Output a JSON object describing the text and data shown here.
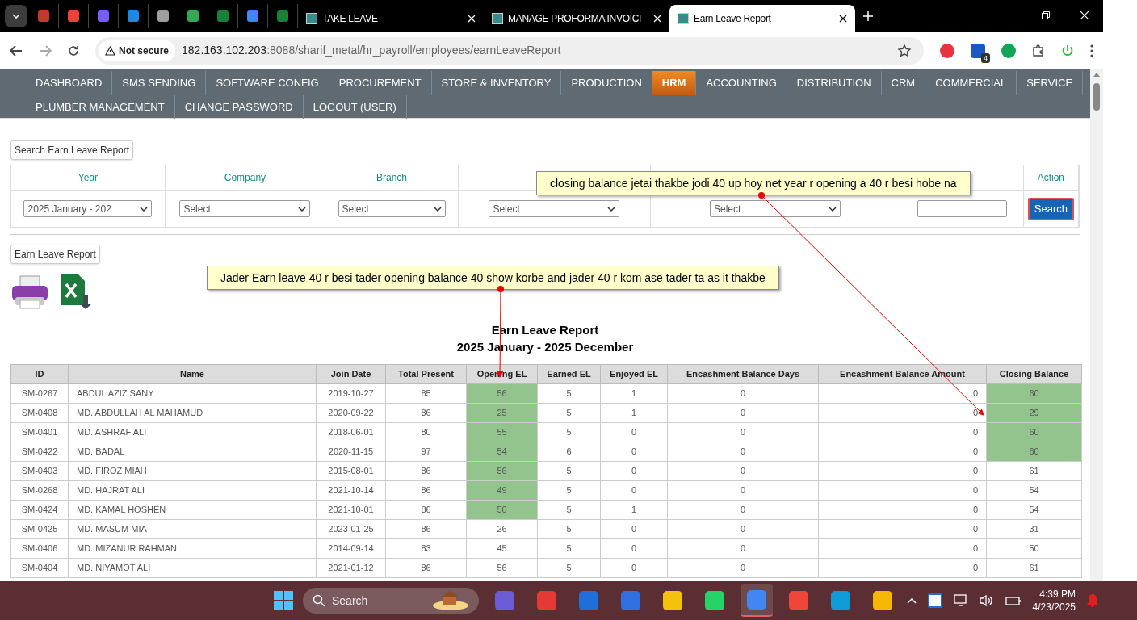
{
  "browser": {
    "tabs": [
      {
        "kind": "icon",
        "color": "#c0392b"
      },
      {
        "kind": "icon",
        "color": "#ea4335"
      },
      {
        "kind": "icon",
        "color": "#7b5cff"
      },
      {
        "kind": "icon",
        "color": "#1e88e5"
      },
      {
        "kind": "icon",
        "color": "#9e9e9e"
      },
      {
        "kind": "icon",
        "color": "#34a853"
      },
      {
        "kind": "icon",
        "color": "#188038"
      },
      {
        "kind": "icon",
        "color": "#4285f4"
      },
      {
        "kind": "icon",
        "color": "#188038"
      },
      {
        "kind": "titled",
        "title": "TAKE LEAVE",
        "selected": false
      },
      {
        "kind": "titled",
        "title": "MANAGE PROFORMA INVOICI",
        "selected": false
      },
      {
        "kind": "titled",
        "title": "Earn Leave Report",
        "selected": true
      }
    ],
    "security": "Not secure",
    "url_host": "182.163.102.203",
    "url_rest": ":8088/sharif_metal/hr_payroll/employees/earnLeaveReport",
    "extension_badge": "4"
  },
  "menu": [
    [
      {
        "label": "DASHBOARD",
        "selected": false
      },
      {
        "label": "SMS SENDING",
        "selected": false
      },
      {
        "label": "SOFTWARE CONFIG",
        "selected": false
      },
      {
        "label": "PROCUREMENT",
        "selected": false
      },
      {
        "label": "STORE & INVENTORY",
        "selected": false
      },
      {
        "label": "PRODUCTION",
        "selected": false
      },
      {
        "label": "HRM",
        "selected": true
      },
      {
        "label": "ACCOUNTING",
        "selected": false
      },
      {
        "label": "DISTRIBUTION",
        "selected": false
      },
      {
        "label": "CRM",
        "selected": false
      },
      {
        "label": "COMMERCIAL",
        "selected": false
      },
      {
        "label": "SERVICE",
        "selected": false
      }
    ],
    [
      {
        "label": "PLUMBER MANAGEMENT",
        "selected": false
      },
      {
        "label": "CHANGE PASSWORD",
        "selected": false
      },
      {
        "label": "LOGOUT (USER)",
        "selected": false
      }
    ]
  ],
  "search": {
    "legend": "Search Earn Leave Report",
    "columns": [
      {
        "label": "Year",
        "kind": "select",
        "value": "2025 January - 202"
      },
      {
        "label": "Company",
        "kind": "select",
        "value": "Select"
      },
      {
        "label": "Branch",
        "kind": "select",
        "value": "Select"
      },
      {
        "kind": "select",
        "value": "Select"
      },
      {
        "kind": "select",
        "value": "Select"
      },
      {
        "kind": "input"
      },
      {
        "label": "Action",
        "kind": "button",
        "value": "Search"
      }
    ]
  },
  "report": {
    "legend": "Earn Leave Report",
    "title": "Earn Leave Report",
    "period": "2025 January - 2025 December",
    "columns": [
      "ID",
      "Name",
      "Join Date",
      "Total Present",
      "Opening EL",
      "Earned EL",
      "Enjoyed EL",
      "Encashment Balance Days",
      "Encashment Balance Amount",
      "Closing Balance"
    ],
    "rows": [
      {
        "cells": [
          "SM-0267",
          "ABDUL AZIZ SANY",
          "2019-10-27",
          "85",
          "56",
          "5",
          "1",
          "0",
          "0",
          "60"
        ],
        "opening_highlighted": true,
        "closing_highlighted": true
      },
      {
        "cells": [
          "SM-0408",
          "MD. ABDULLAH AL MAHAMUD",
          "2020-09-22",
          "86",
          "25",
          "5",
          "1",
          "0",
          "0",
          "29"
        ],
        "opening_highlighted": true,
        "closing_highlighted": true
      },
      {
        "cells": [
          "SM-0401",
          "MD. ASHRAF ALI",
          "2018-06-01",
          "80",
          "55",
          "5",
          "0",
          "0",
          "0",
          "60"
        ],
        "opening_highlighted": true,
        "closing_highlighted": true
      },
      {
        "cells": [
          "SM-0422",
          "MD. BADAL",
          "2020-11-15",
          "97",
          "54",
          "6",
          "0",
          "0",
          "0",
          "60"
        ],
        "opening_highlighted": true,
        "closing_highlighted": true
      },
      {
        "cells": [
          "SM-0403",
          "MD. FIROZ MIAH",
          "2015-08-01",
          "86",
          "56",
          "5",
          "0",
          "0",
          "0",
          "61"
        ],
        "opening_highlighted": true,
        "closing_highlighted": false
      },
      {
        "cells": [
          "SM-0268",
          "MD. HAJRAT ALI",
          "2021-10-14",
          "86",
          "49",
          "5",
          "0",
          "0",
          "0",
          "54"
        ],
        "opening_highlighted": true,
        "closing_highlighted": false
      },
      {
        "cells": [
          "SM-0424",
          "MD. KAMAL HOSHEN",
          "2021-10-01",
          "86",
          "50",
          "5",
          "1",
          "0",
          "0",
          "54"
        ],
        "opening_highlighted": true,
        "closing_highlighted": false
      },
      {
        "cells": [
          "SM-0425",
          "MD. MASUM MIA",
          "2023-01-25",
          "86",
          "26",
          "5",
          "0",
          "0",
          "0",
          "31"
        ],
        "opening_highlighted": false,
        "closing_highlighted": false
      },
      {
        "cells": [
          "SM-0406",
          "MD. MIZANUR RAHMAN",
          "2014-09-14",
          "83",
          "45",
          "5",
          "0",
          "0",
          "0",
          "50"
        ],
        "opening_highlighted": false,
        "closing_highlighted": false
      },
      {
        "cells": [
          "SM-0404",
          "MD. NIYAMOT ALI",
          "2021-01-12",
          "86",
          "56",
          "5",
          "0",
          "0",
          "0",
          "61"
        ],
        "opening_highlighted": false,
        "closing_highlighted": false
      }
    ]
  },
  "annotations": [
    "closing balance jetai thakbe jodi 40 up hoy net year r opening a 40 r besi hobe na",
    "Jader Earn leave 40 r besi tader opening balance 40 show korbe and jader 40 r kom ase tader ta as it thakbe"
  ],
  "taskbar": {
    "search_placeholder": "Search",
    "time": "4:39 PM",
    "date": "4/23/2025",
    "apps": [
      {
        "color": "#6b5bd6"
      },
      {
        "color": "#e53935"
      },
      {
        "color": "#1e6fd9"
      },
      {
        "color": "#2f6fe0"
      },
      {
        "color": "#f4c20d"
      },
      {
        "color": "#25d366"
      },
      {
        "color": "#4285f4",
        "selected": true
      },
      {
        "color": "#f0453a"
      },
      {
        "color": "#0f9bd7"
      },
      {
        "color": "#f5b700"
      }
    ]
  }
}
